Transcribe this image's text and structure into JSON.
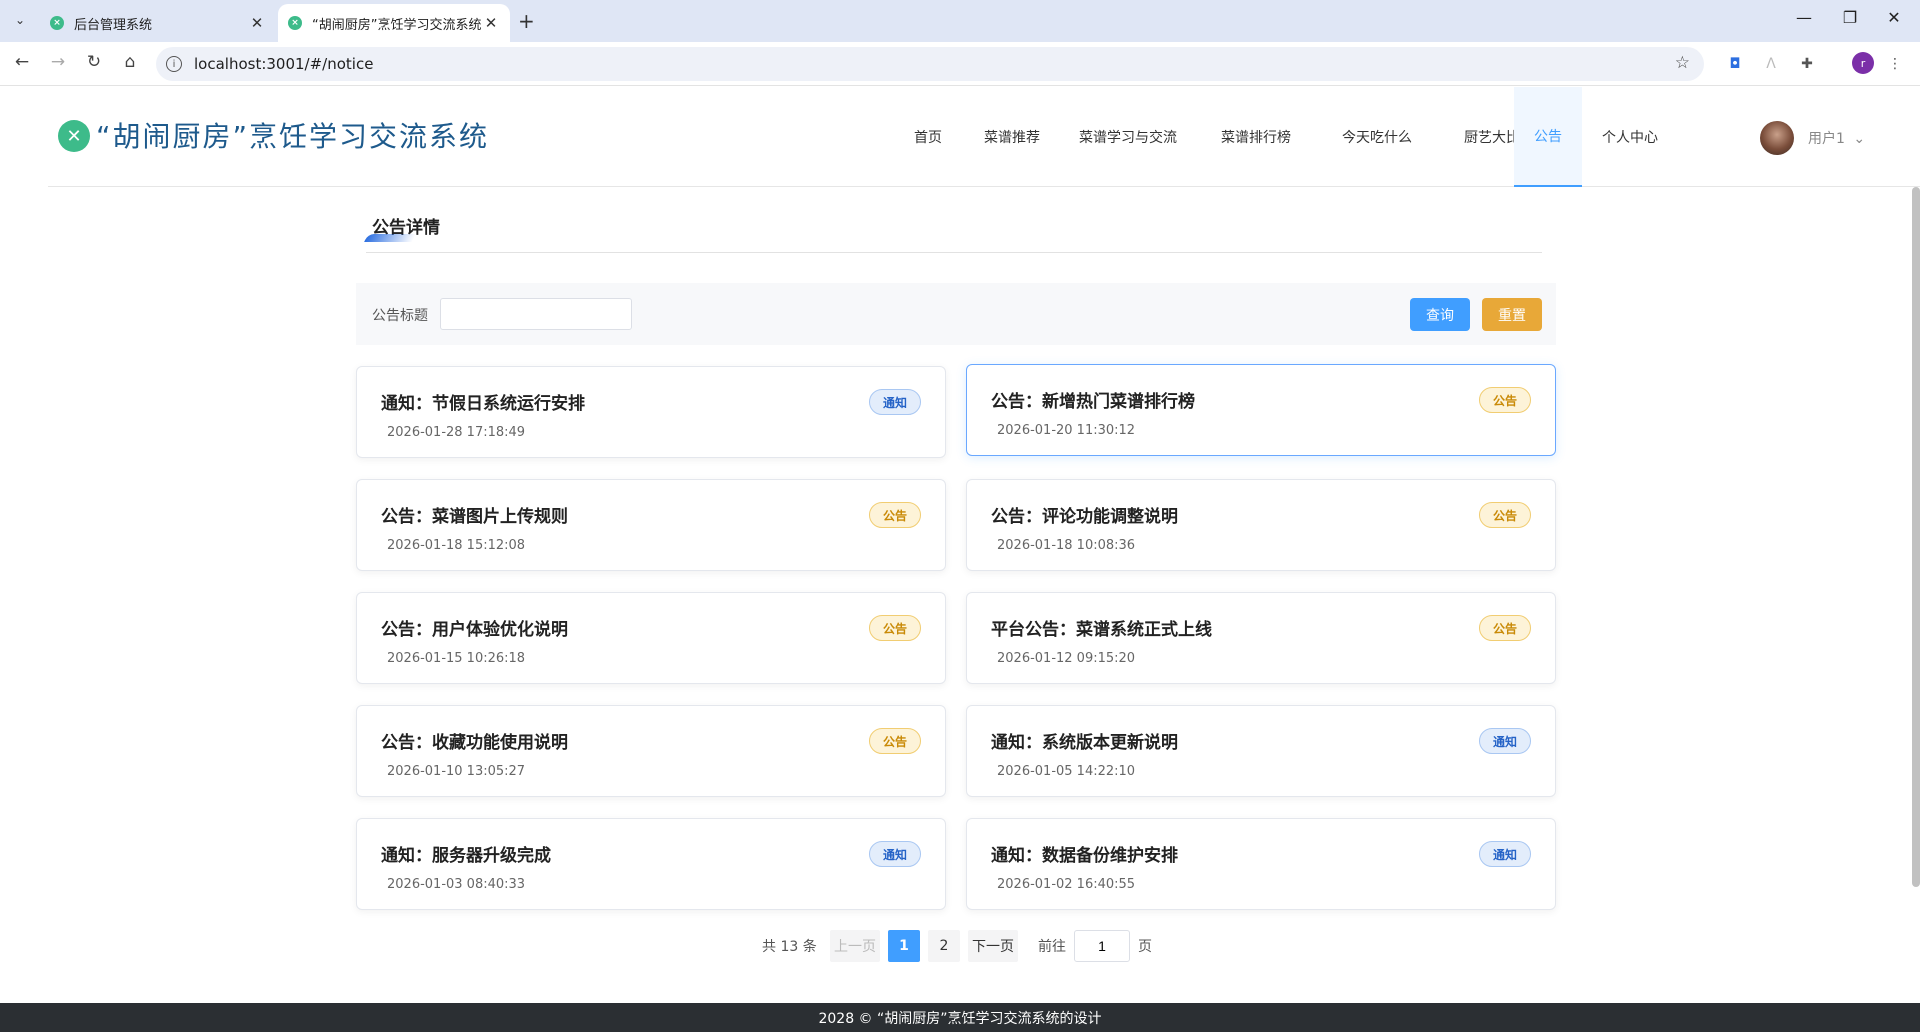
{
  "browser": {
    "tabs": [
      {
        "title": "后台管理系统"
      },
      {
        "title": "“胡闹厨房”烹饪学习交流系统"
      }
    ],
    "url": "localhost:3001/#/notice",
    "profile_initial": "r"
  },
  "header": {
    "site_title": "“胡闹厨房”烹饪学习交流系统",
    "menu": [
      "首页",
      "菜谱推荐",
      "菜谱学习与交流",
      "菜谱排行榜",
      "今天吃什么",
      "厨艺大比拼",
      "公告",
      "个人中心"
    ],
    "active_menu": "公告",
    "user_name": "用户1"
  },
  "section": {
    "title": "公告详情"
  },
  "search": {
    "label": "公告标题",
    "value": "",
    "query_label": "查询",
    "reset_label": "重置"
  },
  "notices": [
    {
      "title": "通知：节假日系统运行安排",
      "date": "2026-01-28 17:18:49",
      "badge": "通知",
      "type": "notice"
    },
    {
      "title": "公告：新增热门菜谱排行榜",
      "date": "2026-01-20 11:30:12",
      "badge": "公告",
      "type": "announce"
    },
    {
      "title": "公告：菜谱图片上传规则",
      "date": "2026-01-18 15:12:08",
      "badge": "公告",
      "type": "announce"
    },
    {
      "title": "公告：评论功能调整说明",
      "date": "2026-01-18 10:08:36",
      "badge": "公告",
      "type": "announce"
    },
    {
      "title": "公告：用户体验优化说明",
      "date": "2026-01-15 10:26:18",
      "badge": "公告",
      "type": "announce"
    },
    {
      "title": "平台公告：菜谱系统正式上线",
      "date": "2026-01-12 09:15:20",
      "badge": "公告",
      "type": "announce"
    },
    {
      "title": "公告：收藏功能使用说明",
      "date": "2026-01-10 13:05:27",
      "badge": "公告",
      "type": "announce"
    },
    {
      "title": "通知：系统版本更新说明",
      "date": "2026-01-05 14:22:10",
      "badge": "通知",
      "type": "notice"
    },
    {
      "title": "通知：服务器升级完成",
      "date": "2026-01-03 08:40:33",
      "badge": "通知",
      "type": "notice"
    },
    {
      "title": "通知：数据备份维护安排",
      "date": "2026-01-02 16:40:55",
      "badge": "通知",
      "type": "notice"
    }
  ],
  "pagination": {
    "total_text": "共 13 条",
    "prev_label": "上一页",
    "pages": [
      "1",
      "2"
    ],
    "current_page": "1",
    "next_label": "下一页",
    "goto_label": "前往",
    "goto_value": "1",
    "page_suffix": "页"
  },
  "footer": {
    "text": "2028 © “胡闹厨房”烹饪学习交流系统的设计"
  },
  "colors": {
    "primary": "#409eff",
    "reset": "#e8a838",
    "brand_title": "#1e5a8c",
    "logo": "#3dbb8a",
    "footer": "#2b2f33"
  }
}
